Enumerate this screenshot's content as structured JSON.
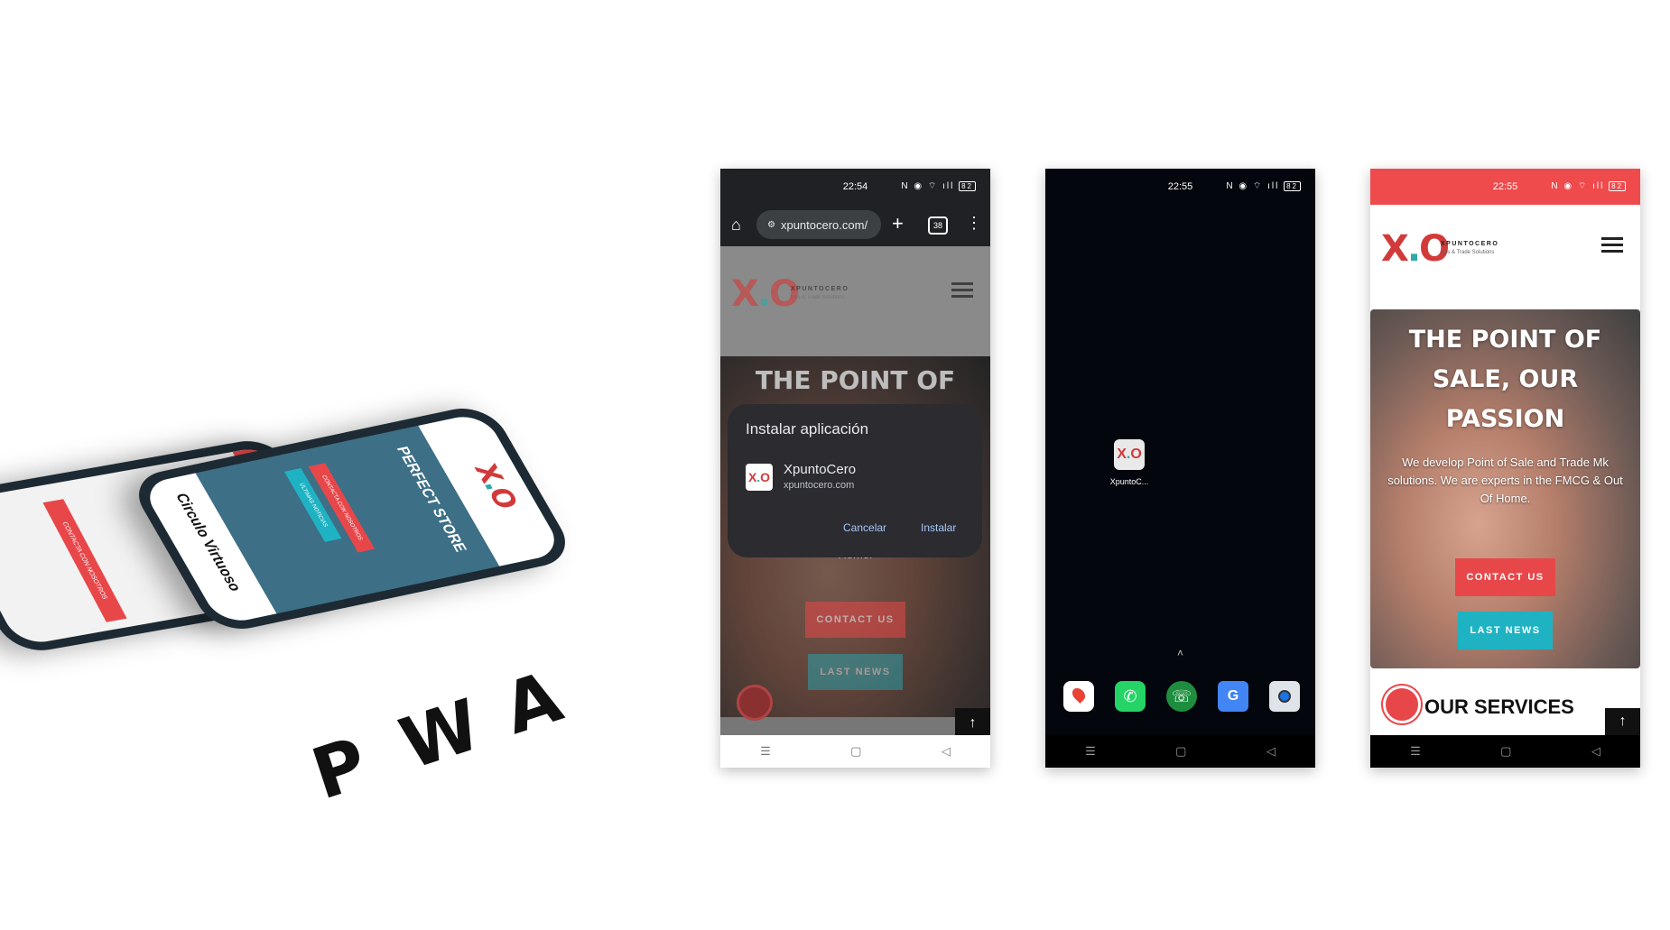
{
  "left": {
    "pwa_letters": [
      "P",
      "W",
      "A"
    ],
    "mock_front": {
      "banner": "PERFECT STORE",
      "sub": "Circulo Virtuoso",
      "badge_contact": "CONTACTA CON NOSOTROS",
      "badge_news": "ÚLTIMAS NOTICIAS"
    },
    "mock_back": {
      "cta": "CONTACTA CON NOSOTROS"
    }
  },
  "shot1": {
    "time": "22:54",
    "battery": "82",
    "url": "xpuntocero.com/",
    "tabs_count": "38",
    "brand_name": "XPUNTOCERO",
    "brand_tag": "Pos & Trade Solutions",
    "hero_title": "THE POINT OF",
    "hero_tail": "Home.",
    "dialog": {
      "title": "Instalar aplicación",
      "app_name": "XpuntoCero",
      "app_url": "xpuntocero.com",
      "cancel": "Cancelar",
      "install": "Instalar"
    },
    "btn_contact": "CONTACT US",
    "btn_news": "LAST NEWS"
  },
  "shot2": {
    "time": "22:55",
    "battery": "82",
    "app_label": "XpuntoC...",
    "dock_icons": [
      "maps-icon",
      "whatsapp-icon",
      "phone-icon",
      "translate-icon",
      "camera-icon"
    ]
  },
  "shot3": {
    "time": "22:55",
    "battery": "82",
    "brand_name": "XPUNTOCERO",
    "brand_tag": "Pos & Trade Solutions",
    "hero_title": "THE POINT OF SALE, OUR PASSION",
    "hero_text": "We develop Point of Sale and Trade Mk solutions. We are experts in the FMCG & Out Of Home.",
    "btn_contact": "CONTACT US",
    "btn_news": "LAST NEWS",
    "services": "OUR SERVICES"
  },
  "nav_glyphs": {
    "menu": "☰",
    "home": "▢",
    "back": "◁"
  }
}
